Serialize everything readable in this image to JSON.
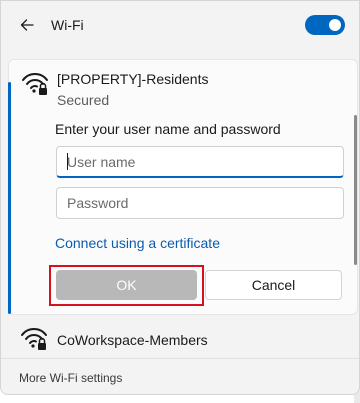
{
  "header": {
    "title": "Wi-Fi",
    "back_icon": "back-arrow-icon",
    "toggle_state": "on",
    "accent_color": "#0067c0"
  },
  "selected_network": {
    "name": "[PROPERTY]-Residents",
    "status": "Secured",
    "icon": "wifi-secured-icon",
    "prompt": "Enter your user name and password",
    "username": {
      "value": "",
      "placeholder": "User name"
    },
    "password": {
      "value": "",
      "placeholder": "Password"
    },
    "cert_link": "Connect using a certificate",
    "ok_label": "OK",
    "cancel_label": "Cancel"
  },
  "other_networks": [
    {
      "name": "CoWorkspace-Members",
      "icon": "wifi-secured-icon"
    }
  ],
  "footer": {
    "more_settings": "More Wi-Fi settings"
  },
  "highlight_color": "#d6101d"
}
